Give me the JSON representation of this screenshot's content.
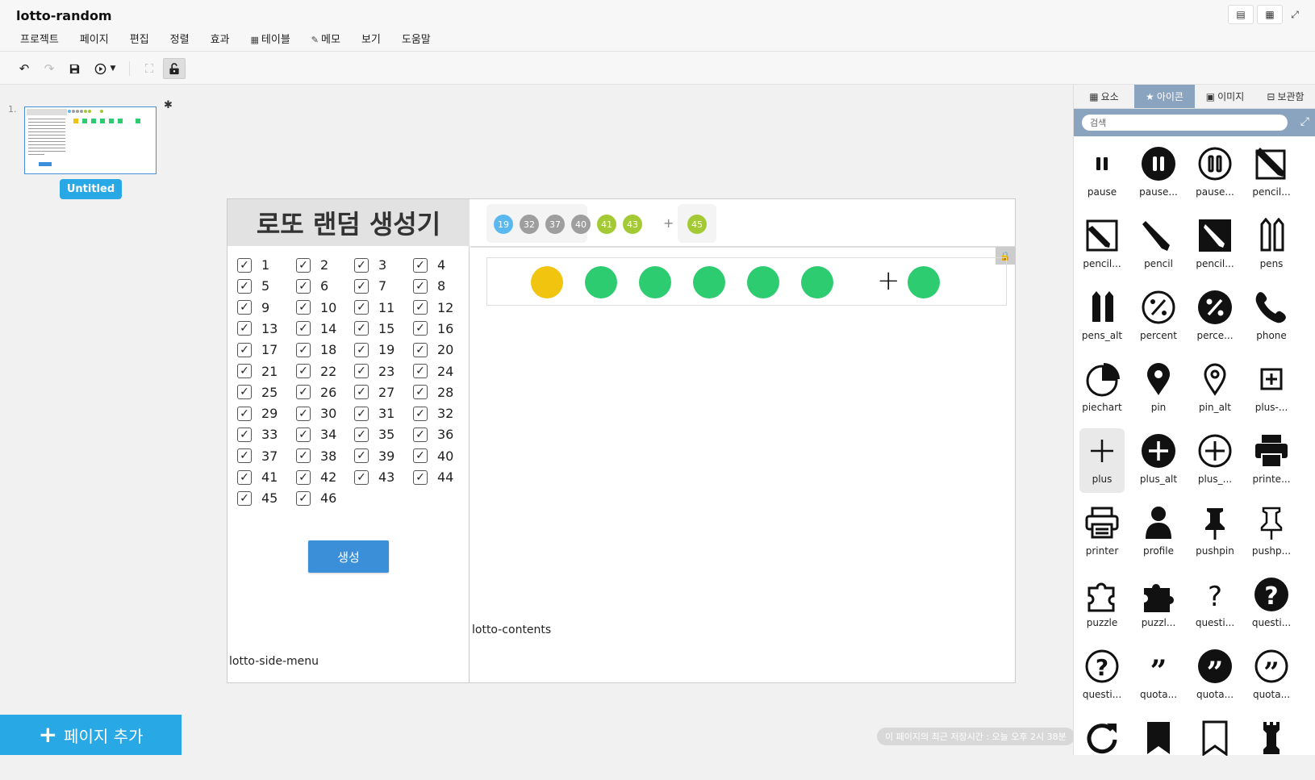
{
  "app": {
    "title": "lotto-random"
  },
  "menu": [
    {
      "label": "프로젝트",
      "icon": ""
    },
    {
      "label": "페이지",
      "icon": ""
    },
    {
      "label": "편집",
      "icon": ""
    },
    {
      "label": "정렬",
      "icon": ""
    },
    {
      "label": "효과",
      "icon": ""
    },
    {
      "label": "테이블",
      "icon": "table-icon"
    },
    {
      "label": "메모",
      "icon": "memo-icon"
    },
    {
      "label": "보기",
      "icon": ""
    },
    {
      "label": "도움말",
      "icon": ""
    }
  ],
  "window_controls": [
    "filmstrip-icon",
    "grid-icon",
    "expand-icon"
  ],
  "toolbar": {
    "buttons": [
      "undo-icon",
      "redo-icon",
      "save-icon",
      "play-icon",
      "dropdown-caret-icon",
      "group-icon",
      "unlock-icon"
    ]
  },
  "pages": [
    {
      "number": "1.",
      "label": "Untitled",
      "settings_icon": "gear-icon"
    }
  ],
  "canvas": {
    "side_title": "로또 랜덤 생성기",
    "side_caption": "lotto-side-menu",
    "contents_caption": "lotto-contents",
    "generate_label": "생성",
    "numbers": [
      "1",
      "2",
      "3",
      "4",
      "5",
      "6",
      "7",
      "8",
      "9",
      "10",
      "11",
      "12",
      "13",
      "14",
      "15",
      "16",
      "17",
      "18",
      "19",
      "20",
      "21",
      "22",
      "23",
      "24",
      "25",
      "26",
      "27",
      "28",
      "29",
      "30",
      "31",
      "32",
      "33",
      "34",
      "35",
      "36",
      "37",
      "38",
      "39",
      "40",
      "41",
      "42",
      "43",
      "44",
      "45",
      "46"
    ],
    "checkmark": "✓",
    "history_balls": [
      {
        "value": "19",
        "color": "#5bb8ee"
      },
      {
        "value": "32",
        "color": "#9e9e9e"
      },
      {
        "value": "37",
        "color": "#9e9e9e"
      },
      {
        "value": "40",
        "color": "#9e9e9e"
      },
      {
        "value": "41",
        "color": "#a3c935"
      },
      {
        "value": "43",
        "color": "#a3c935"
      }
    ],
    "history_bonus": {
      "value": "45",
      "color": "#a3c935"
    },
    "plus_sign": "+",
    "ball_colors": [
      "#f1c40f",
      "#2ecc71",
      "#2ecc71",
      "#2ecc71",
      "#2ecc71",
      "#2ecc71"
    ],
    "bonus_color": "#2ecc71"
  },
  "bottom": {
    "add_page": "페이지 추가",
    "save_status": "이 페이지의 최근 저장시간 : 오늘 오후 2시 38분"
  },
  "panel": {
    "tabs": [
      {
        "label": "요소",
        "icon": "elements-icon"
      },
      {
        "label": "아이콘",
        "icon": "star-icon",
        "active": true
      },
      {
        "label": "이미지",
        "icon": "image-icon"
      },
      {
        "label": "보관함",
        "icon": "storage-icon"
      }
    ],
    "search_placeholder": "검색",
    "icons": [
      {
        "label": "pause",
        "name": "pause"
      },
      {
        "label": "pause...",
        "name": "pause-filled"
      },
      {
        "label": "pause...",
        "name": "pause-outline"
      },
      {
        "label": "pencil...",
        "name": "pencil-box"
      },
      {
        "label": "pencil...",
        "name": "pencil-box-alt"
      },
      {
        "label": "pencil",
        "name": "pencil"
      },
      {
        "label": "pencil...",
        "name": "pencil-solid"
      },
      {
        "label": "pens",
        "name": "pens"
      },
      {
        "label": "pens_alt",
        "name": "pens-alt"
      },
      {
        "label": "percent",
        "name": "percent"
      },
      {
        "label": "perce...",
        "name": "percent-solid"
      },
      {
        "label": "phone",
        "name": "phone"
      },
      {
        "label": "piechart",
        "name": "piechart"
      },
      {
        "label": "pin",
        "name": "pin"
      },
      {
        "label": "pin_alt",
        "name": "pin-alt"
      },
      {
        "label": "plus-...",
        "name": "plus-square"
      },
      {
        "label": "plus",
        "name": "plus",
        "selected": true
      },
      {
        "label": "plus_alt",
        "name": "plus-alt"
      },
      {
        "label": "plus_...",
        "name": "plus-outline"
      },
      {
        "label": "printe...",
        "name": "printer-solid"
      },
      {
        "label": "printer",
        "name": "printer"
      },
      {
        "label": "profile",
        "name": "profile"
      },
      {
        "label": "pushpin",
        "name": "pushpin"
      },
      {
        "label": "pushp...",
        "name": "pushpin-outline"
      },
      {
        "label": "puzzle",
        "name": "puzzle"
      },
      {
        "label": "puzzl...",
        "name": "puzzle-solid"
      },
      {
        "label": "questi...",
        "name": "question"
      },
      {
        "label": "questi...",
        "name": "question-solid"
      },
      {
        "label": "questi...",
        "name": "question-outline"
      },
      {
        "label": "quota...",
        "name": "quotation"
      },
      {
        "label": "quota...",
        "name": "quotation-solid"
      },
      {
        "label": "quota...",
        "name": "quotation-outline"
      },
      {
        "label": "",
        "name": "redo"
      },
      {
        "label": "",
        "name": "bookmark"
      },
      {
        "label": "",
        "name": "bookmark-outline"
      },
      {
        "label": "",
        "name": "rook"
      }
    ]
  }
}
